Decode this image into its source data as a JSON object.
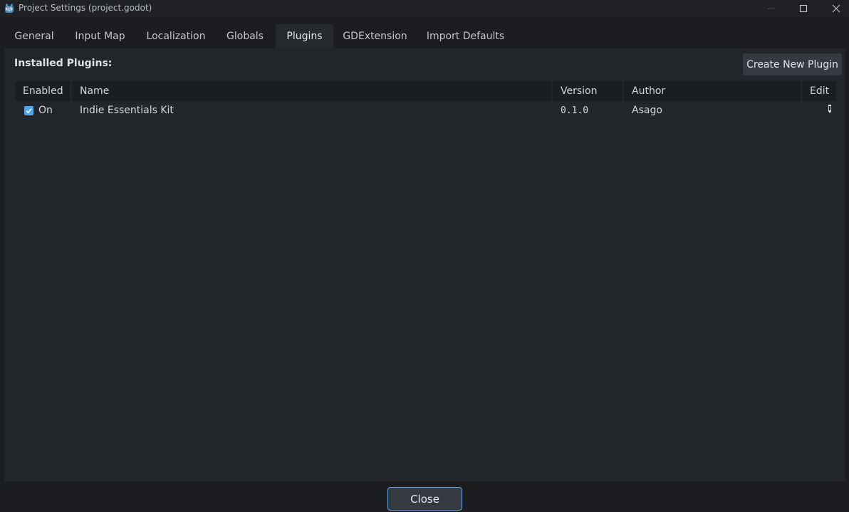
{
  "window": {
    "title": "Project Settings (project.godot)",
    "icon": "godot-logo-icon"
  },
  "tabs": [
    {
      "label": "General"
    },
    {
      "label": "Input Map"
    },
    {
      "label": "Localization"
    },
    {
      "label": "Globals"
    },
    {
      "label": "Plugins",
      "active": true
    },
    {
      "label": "GDExtension"
    },
    {
      "label": "Import Defaults"
    }
  ],
  "plugins_panel": {
    "heading": "Installed Plugins:",
    "create_button": "Create New Plugin",
    "columns": [
      "Enabled",
      "Name",
      "Version",
      "Author",
      "Edit"
    ],
    "rows": [
      {
        "enabled": true,
        "enabled_label": "On",
        "name": "Indie Essentials Kit",
        "version": "0.1.0",
        "author": "Asago",
        "edit_icon": "edit-pencil-icon"
      }
    ]
  },
  "footer": {
    "close_label": "Close"
  },
  "colors": {
    "background": "#1b1d21",
    "panel": "#22262b",
    "accent": "#4ca6ec",
    "focus_border": "#61a6e8"
  }
}
